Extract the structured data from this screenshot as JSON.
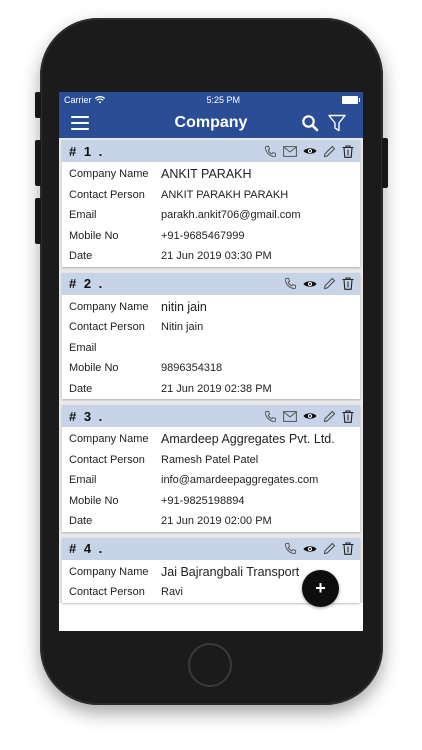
{
  "status": {
    "carrier": "Carrier",
    "time": "5:25 PM"
  },
  "nav": {
    "title": "Company"
  },
  "labels": {
    "company_name": "Company Name",
    "contact_person": "Contact Person",
    "email": "Email",
    "mobile": "Mobile No",
    "date": "Date"
  },
  "companies": [
    {
      "num": "# 1 .",
      "company_name": "ANKIT PARAKH",
      "contact_person": "ANKIT PARAKH PARAKH",
      "email": "parakh.ankit706@gmail.com",
      "mobile": "+91-9685467999",
      "date": "21 Jun 2019 03:30 PM"
    },
    {
      "num": "# 2 .",
      "company_name": "nitin jain",
      "contact_person": "Nitin jain",
      "email": "",
      "mobile": "9896354318",
      "date": "21 Jun 2019 02:38 PM"
    },
    {
      "num": "# 3 .",
      "company_name": "Amardeep Aggregates Pvt. Ltd.",
      "contact_person": "Ramesh Patel Patel",
      "email": "info@amardeepaggregates.com",
      "mobile": "+91-9825198894",
      "date": "21 Jun 2019 02:00 PM"
    },
    {
      "num": "# 4 .",
      "company_name": "Jai Bajrangbali Transport",
      "contact_person": "Ravi"
    }
  ],
  "fab": {
    "label": "+"
  },
  "icons": {
    "menu": "hamburger-icon",
    "search": "search-icon",
    "filter": "filter-icon",
    "call": "phone-icon",
    "mail": "mail-icon",
    "view": "eye-icon",
    "edit": "pencil-icon",
    "delete": "trash-icon"
  },
  "colors": {
    "nav_bg": "#2b4d96",
    "card_header": "#c7d3e7",
    "fab": "#0e0e0e"
  }
}
